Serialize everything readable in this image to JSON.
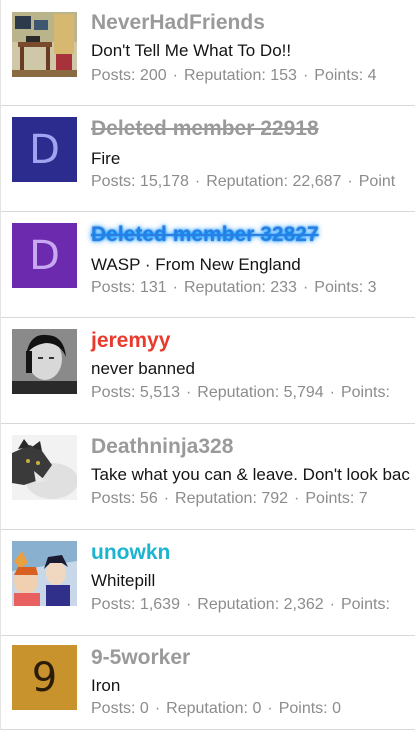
{
  "colors": {
    "username_gray": "#9a9a9a",
    "username_red": "#e83a2d",
    "username_teal": "#1cb4d0",
    "username_blue": "#2a7fe0",
    "stats_gray": "#8c8c8c",
    "avatar_indigo": "#2c2c8e",
    "avatar_purple": "#6c2aae",
    "avatar_gold": "#c8922c"
  },
  "members": [
    {
      "username": "NeverHadFriends",
      "title": "Don't Tell Me What To Do!!",
      "avatar": "room-image",
      "stats": {
        "posts_label": "Posts:",
        "posts": "200",
        "rep_label": "Reputation:",
        "rep": "153",
        "points_label": "Points:",
        "points": "4"
      }
    },
    {
      "username": "Deleted member 22918",
      "title": "Fire",
      "avatar_letter": "D",
      "stats": {
        "posts_label": "Posts:",
        "posts": "15,178",
        "rep_label": "Reputation:",
        "rep": "22,687",
        "points_label": "Point",
        "points": ""
      }
    },
    {
      "username": "Deleted member 32827",
      "title": "WASP · From New England",
      "avatar_letter": "D",
      "stats": {
        "posts_label": "Posts:",
        "posts": "131",
        "rep_label": "Reputation:",
        "rep": "233",
        "points_label": "Points:",
        "points": "3"
      }
    },
    {
      "username": "jeremyy",
      "title": "never banned",
      "avatar": "portrait-photo",
      "stats": {
        "posts_label": "Posts:",
        "posts": "5,513",
        "rep_label": "Reputation:",
        "rep": "5,794",
        "points_label": "Points:",
        "points": ""
      }
    },
    {
      "username": "Deathninja328",
      "title": "Take what you can & leave. Don't look bac",
      "avatar": "cat-photo",
      "stats": {
        "posts_label": "Posts:",
        "posts": "56",
        "rep_label": "Reputation:",
        "rep": "792",
        "points_label": "Points:",
        "points": "7"
      }
    },
    {
      "username": "unowkn",
      "title": "Whitepill",
      "avatar": "anime-image",
      "stats": {
        "posts_label": "Posts:",
        "posts": "1,639",
        "rep_label": "Reputation:",
        "rep": "2,362",
        "points_label": "Points:",
        "points": ""
      }
    },
    {
      "username": "9-5worker",
      "title": "Iron",
      "avatar_letter": "9",
      "stats": {
        "posts_label": "Posts:",
        "posts": "0",
        "rep_label": "Reputation:",
        "rep": "0",
        "points_label": "Points:",
        "points": "0"
      }
    }
  ]
}
